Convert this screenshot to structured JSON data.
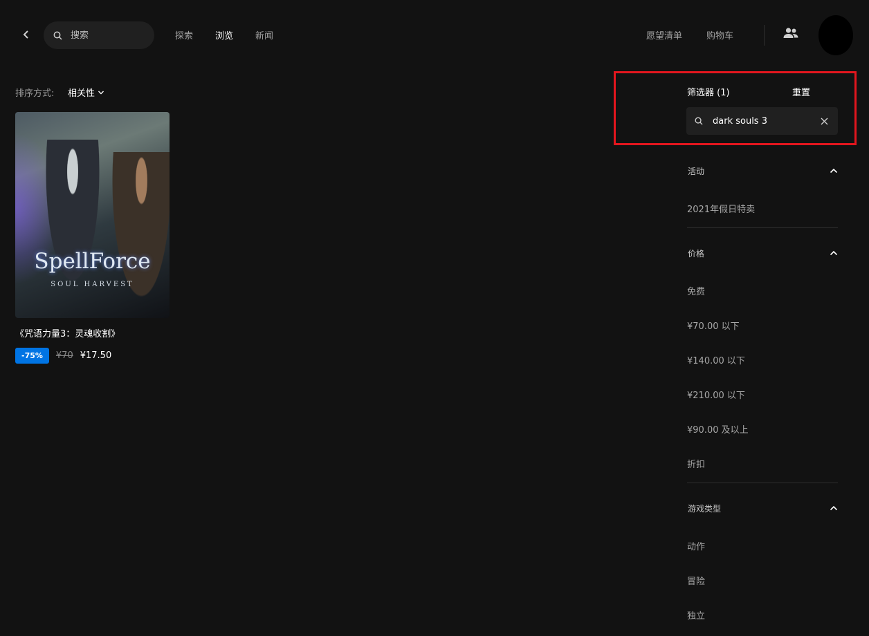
{
  "nav": {
    "search_placeholder": "搜索",
    "links": [
      "探索",
      "浏览",
      "新闻"
    ],
    "wishlist": "愿望清单",
    "cart": "购物车"
  },
  "sort": {
    "label": "排序方式:",
    "value": "相关性"
  },
  "product": {
    "cover_title": "SpellForce",
    "cover_subtitle": "SOUL HARVEST",
    "title": "《咒语力量3：灵魂收割》",
    "discount": "-75%",
    "original_price": "¥70",
    "sale_price": "¥17.50"
  },
  "filters": {
    "title": "筛选器 (1)",
    "reset": "重置",
    "search_value": "dark souls 3",
    "sections": {
      "events": {
        "title": "活动",
        "options": [
          "2021年假日特卖"
        ]
      },
      "price": {
        "title": "价格",
        "options": [
          "免费",
          "¥70.00 以下",
          "¥140.00 以下",
          "¥210.00 以下",
          "¥90.00 及以上",
          "折扣"
        ]
      },
      "genre": {
        "title": "游戏类型",
        "options": [
          "动作",
          "冒险",
          "独立"
        ]
      }
    }
  },
  "colors": {
    "background": "#121212",
    "accent": "#0074e4",
    "highlight": "#e3161e"
  }
}
